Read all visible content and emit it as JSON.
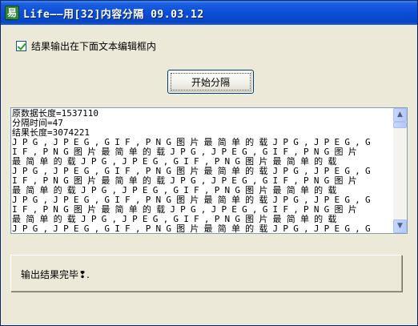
{
  "window": {
    "title": "Life——用[32]内容分隔 09.03.12",
    "icon": "app-icon"
  },
  "options": {
    "output_checkbox_label": "结果输出在下面文本编辑框内",
    "output_checkbox_checked": true
  },
  "actions": {
    "start_button_label": "开始分隔"
  },
  "output": {
    "lines": [
      "原数据长度=1537110",
      "分隔时间=47",
      "结果长度=3074221",
      "JPG,JPEG,GIF,PNG图片最简单的载JPG,JPEG,G",
      "IF,PNG图片最简单的载JPG,JPEG,GIF,PNG图片",
      "最简单的载JPG,JPEG,GIF,PNG图片最简单的载",
      "JPG,JPEG,GIF,PNG图片最简单的载JPG,JPEG,G",
      "IF,PNG图片最简单的载JPG,JPEG,GIF,PNG图片",
      "最简单的载JPG,JPEG,GIF,PNG图片最简单的载",
      "JPG,JPEG,GIF,PNG图片最简单的载JPG,JPEG,G",
      "IF,PNG图片最简单的载JPG,JPEG,GIF,PNG图片",
      "最简单的载JPG,JPEG,GIF,PNG图片最简单的载",
      "JPG,JPEG,GIF,PNG图片最简单的载JPG,JPEG,G"
    ]
  },
  "status": {
    "message": "输出结果完毕❢."
  },
  "colors": {
    "titlebar": "#0a4ed8",
    "face": "#ece9d8",
    "edit_border": "#7f9db9"
  }
}
